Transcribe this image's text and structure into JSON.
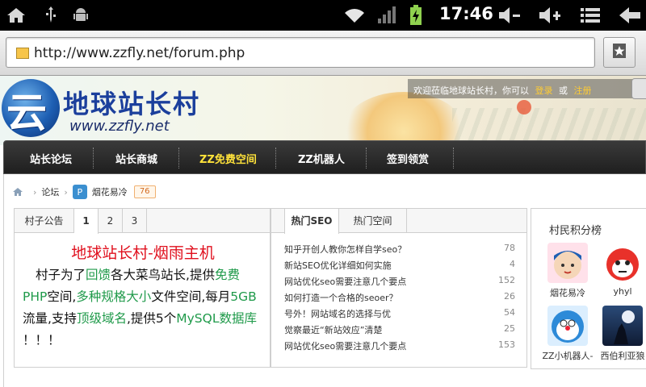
{
  "status_bar": {
    "time": "17:46",
    "icons": [
      "home-icon",
      "usb-icon",
      "android-debug-icon",
      "wifi-icon",
      "signal-icon",
      "battery-charging-icon",
      "volume-down-icon",
      "volume-up-icon",
      "menu-icon",
      "back-icon"
    ]
  },
  "browser": {
    "url": "http://www.zzfly.net/forum.php"
  },
  "header": {
    "logo_title": "地球站长村",
    "logo_url": "www.zzfly.net",
    "welcome_text": "欢迎莅临地球站长村，你可以",
    "login": "登录",
    "or": "或",
    "register": "注册"
  },
  "nav": {
    "items": [
      {
        "label": "站长论坛"
      },
      {
        "label": "站长商城"
      },
      {
        "label": "ZZ免费空间"
      },
      {
        "label": "ZZ机器人"
      },
      {
        "label": "签到领赏"
      }
    ]
  },
  "breadcrumb": {
    "forum": "论坛",
    "user": "烟花易冷",
    "count": "76"
  },
  "notice_panel": {
    "tabs": [
      "村子公告",
      "1",
      "2",
      "3"
    ],
    "title": "地球站长村-烟雨主机",
    "segments": [
      {
        "text": "村子为了",
        "cls": ""
      },
      {
        "text": "回馈",
        "cls": "g"
      },
      {
        "text": "各大菜鸟站长,提供",
        "cls": ""
      },
      {
        "text": "免费PHP",
        "cls": "g"
      },
      {
        "text": "空间,",
        "cls": ""
      },
      {
        "text": "多种规格大小",
        "cls": "g"
      },
      {
        "text": "文件空间,每月",
        "cls": ""
      },
      {
        "text": "5GB",
        "cls": "g"
      },
      {
        "text": "流量,支持",
        "cls": ""
      },
      {
        "text": "顶级域名",
        "cls": "g"
      },
      {
        "text": ",提供5个",
        "cls": ""
      },
      {
        "text": "MySQL数据库",
        "cls": "g"
      },
      {
        "text": " ！！！",
        "cls": ""
      }
    ]
  },
  "hot_panel": {
    "tabs": [
      "热门SEO",
      "热门空间"
    ],
    "rows": [
      {
        "title": "知乎开创人教你怎样自学seo？",
        "count": "78"
      },
      {
        "title": "新站SEO优化详细如何实施",
        "count": "4"
      },
      {
        "title": "网站优化seo需要注意几个要点",
        "count": "152"
      },
      {
        "title": "如何打造一个合格的seoer？",
        "count": "26"
      },
      {
        "title": "号外！网站域名的选择与优",
        "count": "54"
      },
      {
        "title": "觉察最近“新站效应”清楚",
        "count": "25"
      },
      {
        "title": "网站优化seo需要注意几个要点",
        "count": "153"
      }
    ]
  },
  "rank_panel": {
    "title": "村民积分榜",
    "users": [
      {
        "name": "烟花易冷"
      },
      {
        "name": "yhyl"
      },
      {
        "name": "ZZ小机器人-"
      },
      {
        "name": "西伯利亚狼"
      }
    ]
  }
}
